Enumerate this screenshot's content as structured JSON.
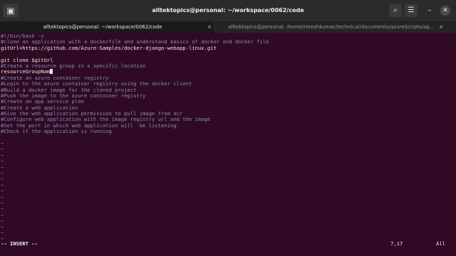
{
  "window": {
    "title": "alltektopics@personal: ~/workspace/0062/code",
    "menu_icon": "terminal-tab-icon",
    "search_icon": "search-icon",
    "hamburger_icon": "hamburger-menu-icon",
    "minimize_icon": "minimize-icon",
    "close_icon": "close-icon"
  },
  "tabs": [
    {
      "label": "alltektopics@personal: ~/workspace/0062/code",
      "close": "×"
    },
    {
      "label": "alltektopics@personal: /home/rineshkumar/technical/documents/azureScripts/ap...",
      "close": "×"
    }
  ],
  "editor": {
    "lines": [
      {
        "text": "#!/bin/bash -x",
        "kind": "comment"
      },
      {
        "text": "#clone an application with a dockerfile and understand basics of docker and docker file",
        "kind": "comment"
      },
      {
        "text": "gitUrl=https://github.com/Azure-Samples/docker-django-webapp-linux.git",
        "kind": "code"
      },
      {
        "text": "",
        "kind": "code"
      },
      {
        "text": "git clone $gitUrl",
        "kind": "code"
      },
      {
        "text": "#Create a resource group in a specific location",
        "kind": "comment"
      },
      {
        "text": "resourceGroupNam",
        "kind": "cursor"
      },
      {
        "text": "#Create an azure container registry",
        "kind": "comment"
      },
      {
        "text": "#Login to the azure container registry using the docker client",
        "kind": "comment"
      },
      {
        "text": "#Build a docker image for the cloned project",
        "kind": "comment"
      },
      {
        "text": "#Push the image to the azure container registry",
        "kind": "comment"
      },
      {
        "text": "#Create an app service plan",
        "kind": "comment"
      },
      {
        "text": "#Create a web application",
        "kind": "comment"
      },
      {
        "text": "#Give the web application permission to pull image from acr",
        "kind": "comment"
      },
      {
        "text": "#Configure web application with the image registry url and the image",
        "kind": "comment"
      },
      {
        "text": "#Set the port in which web application will  be listening",
        "kind": "comment"
      },
      {
        "text": "#Check if the application is running",
        "kind": "comment"
      },
      {
        "text": "",
        "kind": "code"
      },
      {
        "text": "~",
        "kind": "tilde"
      },
      {
        "text": "~",
        "kind": "tilde"
      },
      {
        "text": "~",
        "kind": "tilde"
      },
      {
        "text": "~",
        "kind": "tilde"
      },
      {
        "text": "~",
        "kind": "tilde"
      },
      {
        "text": "~",
        "kind": "tilde"
      },
      {
        "text": "~",
        "kind": "tilde"
      },
      {
        "text": "~",
        "kind": "tilde"
      },
      {
        "text": "~",
        "kind": "tilde"
      },
      {
        "text": "~",
        "kind": "tilde"
      },
      {
        "text": "~",
        "kind": "tilde"
      },
      {
        "text": "~",
        "kind": "tilde"
      },
      {
        "text": "~",
        "kind": "tilde"
      },
      {
        "text": "~",
        "kind": "tilde"
      },
      {
        "text": "~",
        "kind": "tilde"
      },
      {
        "text": "~",
        "kind": "tilde"
      },
      {
        "text": "~",
        "kind": "tilde"
      }
    ]
  },
  "status": {
    "mode": "-- INSERT --",
    "position": "7,17",
    "scroll": "All"
  }
}
